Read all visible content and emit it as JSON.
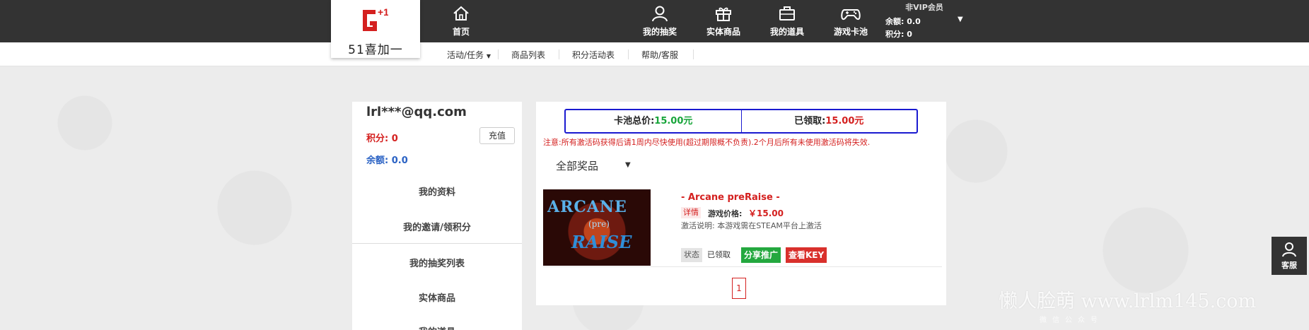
{
  "header": {
    "logo_text": "51喜加一",
    "nav": {
      "home": "首页",
      "lottery": "我的抽奖",
      "goods": "实体商品",
      "props": "我的道具",
      "cards": "游戏卡池"
    },
    "vip": {
      "title": "非VIP会员",
      "balance_label": "余额:",
      "balance_value": "0.0",
      "points_label": "积分:",
      "points_value": "0"
    }
  },
  "subnav": {
    "activity": "活动/任务",
    "products": "商品列表",
    "points_activity": "积分活动表",
    "help": "帮助/客服"
  },
  "sidebar": {
    "email": "lrl***@qq.com",
    "points": "积分: 0",
    "balance": "余额:  0.0",
    "recharge": "充值",
    "menu": [
      "我的资料",
      "我的邀请/领积分",
      "我的抽奖列表",
      "实体商品",
      "我的道具"
    ]
  },
  "main": {
    "pool_total_label": "卡池总价:",
    "pool_total_value": "15.00元",
    "claimed_label": "已领取:",
    "claimed_value": "15.00元",
    "notice": "注意:所有激活码获得后请1周内尽快使用(超过期限概不负责).2个月后所有未使用激活码将失效.",
    "filter": "全部奖品",
    "game": {
      "thumb_title": "ARCANE",
      "thumb_mid": "(pre)",
      "thumb_sub": "RAISE",
      "name": "- Arcane preRaise -",
      "detail": "详情",
      "price_label": "游戏价格:",
      "price_value": "￥15.00",
      "activation_note": "激活说明: 本游戏需在STEAM平台上激活",
      "status_label": "状态",
      "status_value": "已领取",
      "share_button": "分享推广",
      "key_button": "查看KEY"
    },
    "page": "1"
  },
  "service": {
    "label": "客服"
  },
  "watermark": {
    "main": "懒人脸萌 www.lrlm145.com",
    "sub": "微信公众号"
  },
  "colors": {
    "topbar": "#333333",
    "accent_red": "#d4201f",
    "accent_green": "#24a83f",
    "accent_blue": "#1a1ad0"
  }
}
